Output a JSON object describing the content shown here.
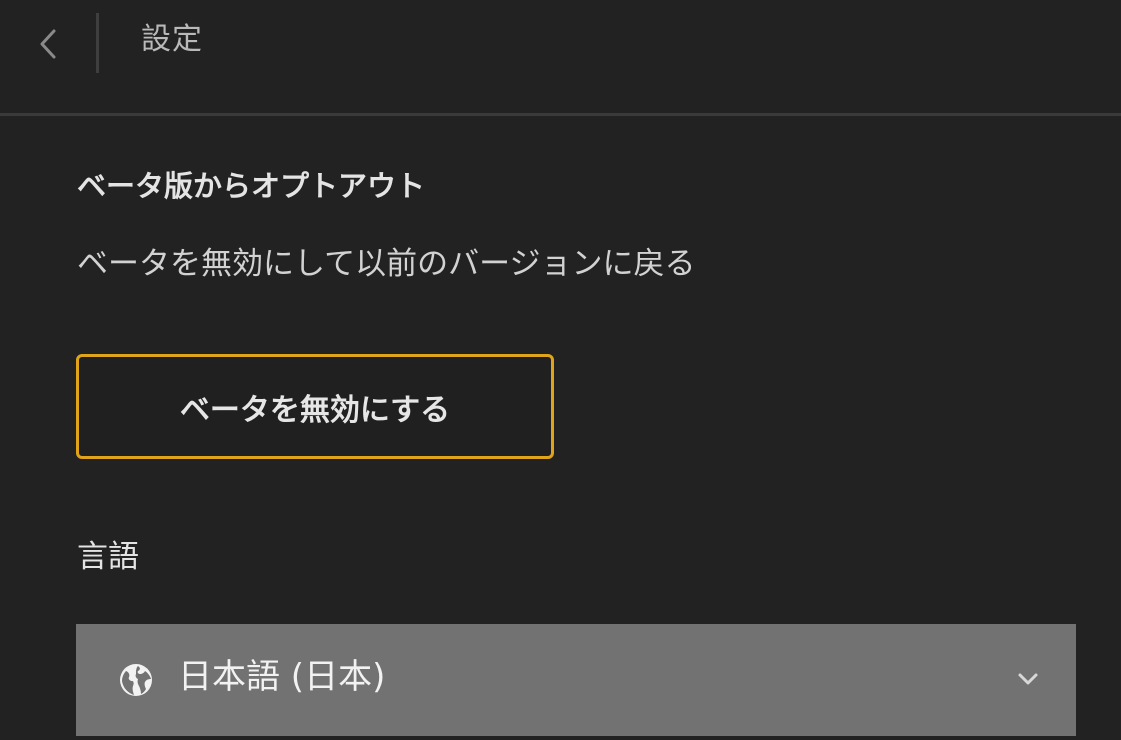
{
  "header": {
    "title": "設定",
    "back_icon": "chevron-left-icon"
  },
  "beta_section": {
    "title": "ベータ版からオプトアウト",
    "description": "ベータを無効にして以前のバージョンに戻る",
    "button_label": "ベータを無効にする",
    "button_border_color": "#e0a41a"
  },
  "language_section": {
    "label": "言語",
    "selected_value": "日本語 (日本)",
    "icon": "globe-icon",
    "dropdown_icon": "chevron-down-icon"
  },
  "colors": {
    "background": "#222222",
    "select_background": "#727272",
    "accent": "#e0a41a"
  }
}
